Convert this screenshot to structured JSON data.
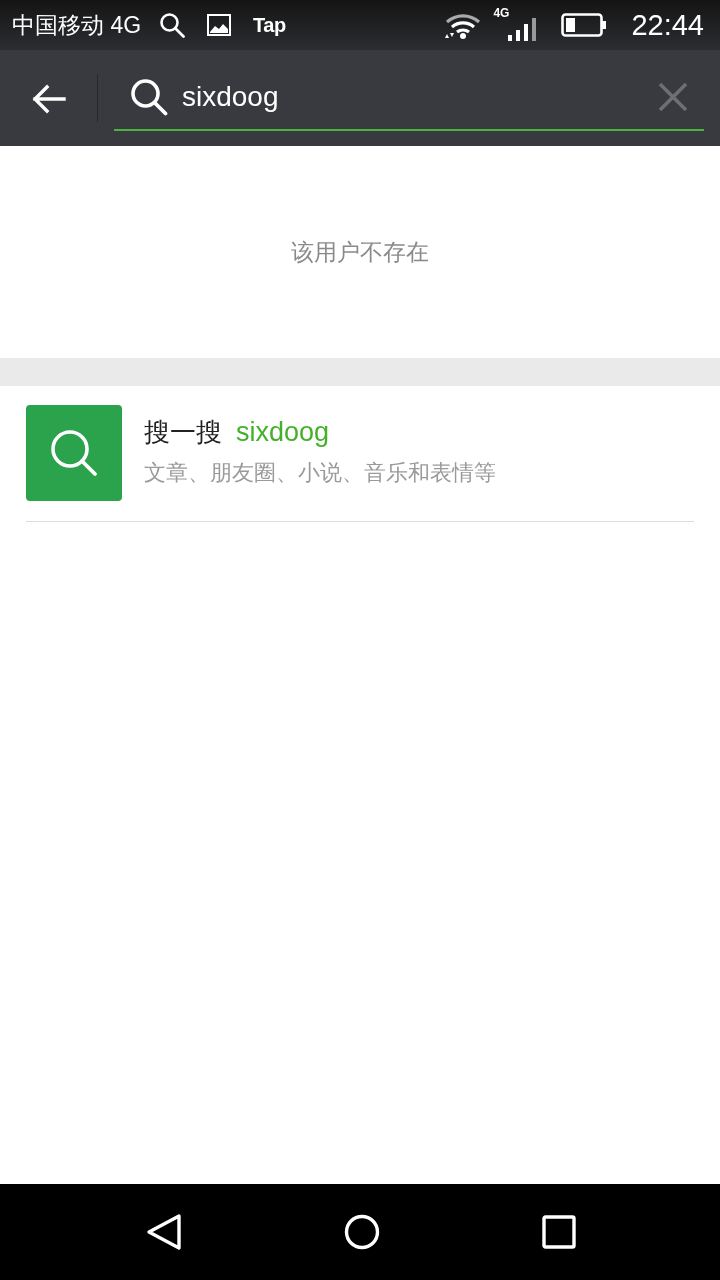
{
  "status_bar": {
    "carrier": "中国移动 4G",
    "notification_text": "Tap",
    "network_type": "4G",
    "time": "22:44"
  },
  "search_bar": {
    "value": "sixdoog"
  },
  "result_message": "该用户不存在",
  "search_suggestion": {
    "title": "搜一搜",
    "query": "sixdoog",
    "subtitle": "文章、朋友圈、小说、音乐和表情等"
  }
}
